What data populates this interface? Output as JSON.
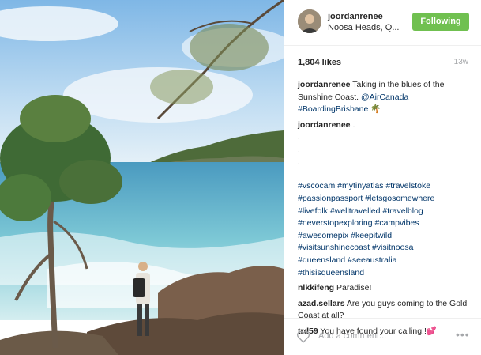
{
  "post": {
    "username": "joordanrenee",
    "location": "Noosa Heads, Q...",
    "follow_label": "Following",
    "likes": "1,804 likes",
    "age": "13w",
    "add_comment_placeholder": "Add a comment...",
    "more_label": "•••"
  },
  "caption": {
    "username": "joordanrenee",
    "text": "Taking in the blues of the Sunshine Coast.",
    "mention": "@AirCanada",
    "tag": "#BoardingBrisbane",
    "emoji": "🌴"
  },
  "hashtag_comment": {
    "username": "joordanrenee",
    "text": ".",
    "dots": [
      ".",
      ".",
      ".",
      "."
    ],
    "lines": [
      "#vscocam #mytinyatlas #travelstoke",
      "#passionpassport #letsgosomewhere",
      "#livefolk #welltravelled #travelblog",
      "#neverstopexploring #campvibes",
      "#awesomepix #keepitwild",
      "#visitsunshinecoast #visitnoosa",
      "#queensland #seeaustralia",
      "#thisisqueensland"
    ]
  },
  "comments": [
    {
      "username": "nlkkifeng",
      "text": "Paradise!"
    },
    {
      "username": "azad.sellars",
      "text": "Are you guys coming to the Gold Coast at all?"
    },
    {
      "username": "trd59",
      "text": "You have found your calling!!💕"
    }
  ],
  "colors": {
    "follow_button": "#70c050",
    "link": "#003569",
    "muted": "#a5a7aa"
  },
  "icons": {
    "heart": "heart-icon",
    "more": "more-options-icon"
  }
}
